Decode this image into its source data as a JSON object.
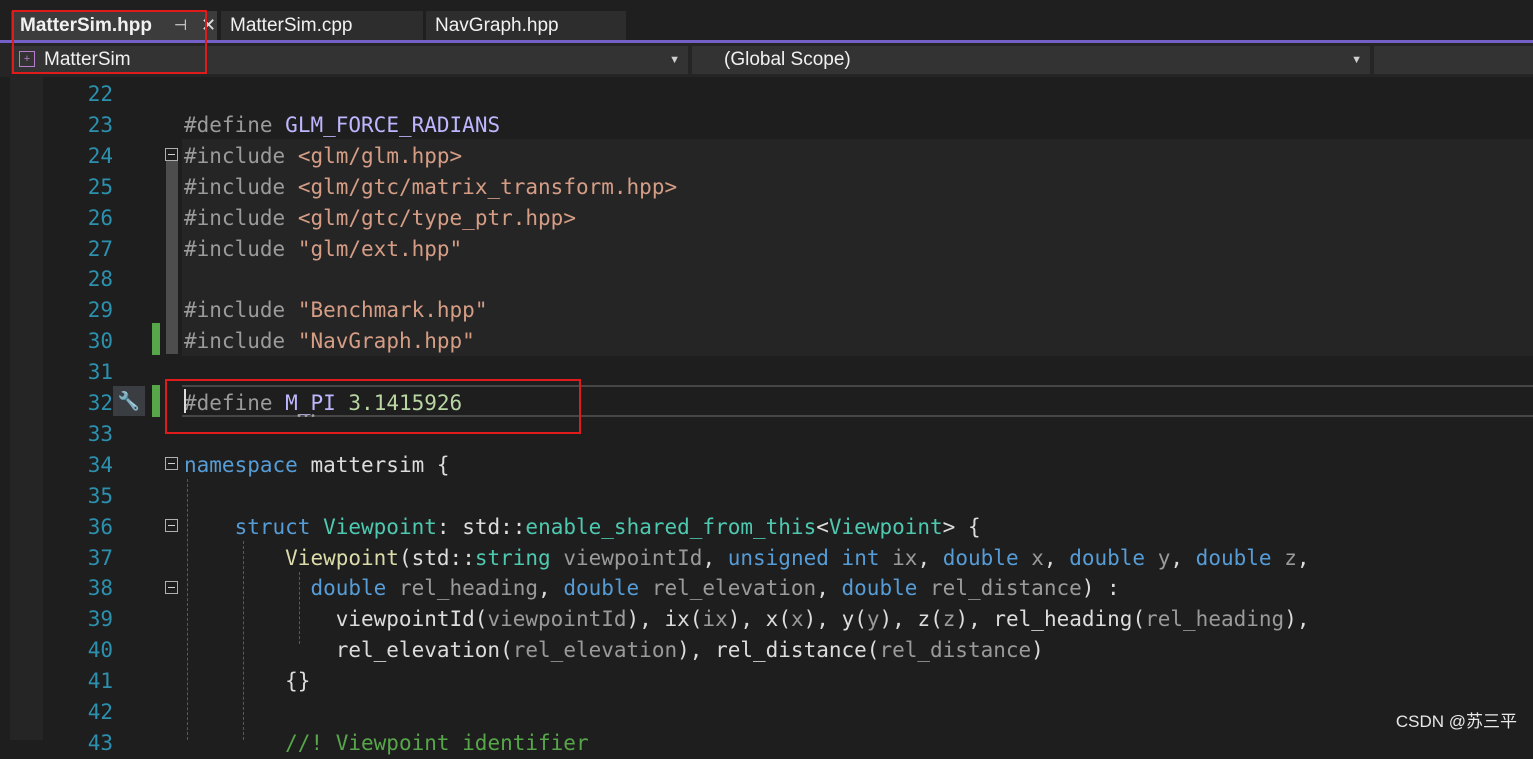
{
  "tabs": [
    {
      "label": "MatterSim.hpp",
      "active": true
    },
    {
      "label": "MatterSim.cpp",
      "active": false
    },
    {
      "label": "NavGraph.hpp",
      "active": false
    }
  ],
  "tab_icons": {
    "pin": "pin-icon",
    "close": "close-icon"
  },
  "nav": {
    "project": "MatterSim",
    "scope": "(Global Scope)"
  },
  "lines": [
    {
      "n": "22",
      "code": ""
    },
    {
      "n": "23",
      "code": "<span class=\"pp\">#define</span> <span class=\"m\">GLM_FORCE_RADIANS</span>"
    },
    {
      "n": "24",
      "code": "<span class=\"pp\">#include</span> <span class=\"s\">&lt;glm/glm.hpp&gt;</span>"
    },
    {
      "n": "25",
      "code": "<span class=\"pp\">#include</span> <span class=\"s\">&lt;glm/gtc/matrix_transform.hpp&gt;</span>"
    },
    {
      "n": "26",
      "code": "<span class=\"pp\">#include</span> <span class=\"s\">&lt;glm/gtc/type_ptr.hpp&gt;</span>"
    },
    {
      "n": "27",
      "code": "<span class=\"pp\">#include</span> <span class=\"s\">\"glm/ext.hpp\"</span>"
    },
    {
      "n": "28",
      "code": ""
    },
    {
      "n": "29",
      "code": "<span class=\"pp\">#include</span> <span class=\"s\">\"Benchmark.hpp\"</span>"
    },
    {
      "n": "30",
      "code": "<span class=\"pp\">#include</span> <span class=\"s\">\"NavGraph.hpp\"</span>"
    },
    {
      "n": "31",
      "code": ""
    },
    {
      "n": "32",
      "code": "<span class=\"pp\">#define</span> <span class=\"m\">M_PI</span> <span class=\"n\">3.1415926</span>"
    },
    {
      "n": "33",
      "code": ""
    },
    {
      "n": "34",
      "code": "<span class=\"k\">namespace</span> <span class=\"d\">mattersim</span> {"
    },
    {
      "n": "35",
      "code": ""
    },
    {
      "n": "36",
      "code": "    <span class=\"k\">struct</span> <span class=\"t\">Viewpoint</span>: <span class=\"d\">std</span>::<span class=\"t\">enable_shared_from_this</span>&lt;<span class=\"t\">Viewpoint</span>&gt; {"
    },
    {
      "n": "37",
      "code": "        <span class=\"f\">Viewpoint</span>(<span class=\"d\">std</span>::<span class=\"t\">string</span> <span class=\"p\">viewpointId</span>, <span class=\"k\">unsigned</span> <span class=\"k\">int</span> <span class=\"p\">ix</span>, <span class=\"k\">double</span> <span class=\"p\">x</span>, <span class=\"k\">double</span> <span class=\"p\">y</span>, <span class=\"k\">double</span> <span class=\"p\">z</span>,"
    },
    {
      "n": "38",
      "code": "          <span class=\"k\">double</span> <span class=\"p\">rel_heading</span>, <span class=\"k\">double</span> <span class=\"p\">rel_elevation</span>, <span class=\"k\">double</span> <span class=\"p\">rel_distance</span>) :"
    },
    {
      "n": "39",
      "code": "            <span class=\"d\">viewpointId</span>(<span class=\"p\">viewpointId</span>), <span class=\"d\">ix</span>(<span class=\"p\">ix</span>), <span class=\"d\">x</span>(<span class=\"p\">x</span>), <span class=\"d\">y</span>(<span class=\"p\">y</span>), <span class=\"d\">z</span>(<span class=\"p\">z</span>), <span class=\"d\">rel_heading</span>(<span class=\"p\">rel_heading</span>),"
    },
    {
      "n": "40",
      "code": "            <span class=\"d\">rel_elevation</span>(<span class=\"p\">rel_elevation</span>), <span class=\"d\">rel_distance</span>(<span class=\"p\">rel_distance</span>)"
    },
    {
      "n": "41",
      "code": "        {}"
    },
    {
      "n": "42",
      "code": ""
    },
    {
      "n": "43",
      "code": "        <span class=\"c\">//! Viewpoint identifier</span>"
    }
  ],
  "watermark": "CSDN @苏三平",
  "colors": {
    "accent": "#7460c7",
    "line_number": "#2b91af",
    "keyword": "#569cd6",
    "highlight_box": "#e01b1b",
    "change_marker": "#57a64a"
  }
}
